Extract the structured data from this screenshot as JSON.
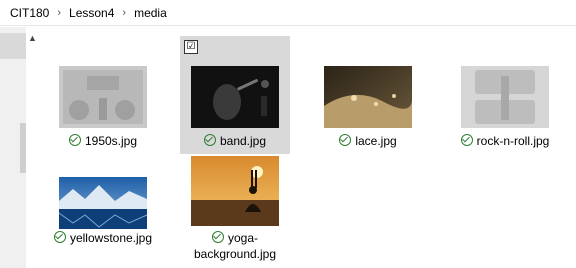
{
  "breadcrumb": {
    "items": [
      "CIT180",
      "Lesson4",
      "media"
    ],
    "separator": "›"
  },
  "files": [
    {
      "name": "1950s.jpg",
      "status": "synced",
      "selected": false
    },
    {
      "name": "band.jpg",
      "status": "synced",
      "selected": true
    },
    {
      "name": "lace.jpg",
      "status": "synced",
      "selected": false
    },
    {
      "name": "rock-n-roll.jpg",
      "status": "synced",
      "selected": false
    },
    {
      "name": "yellowstone.jpg",
      "status": "synced",
      "selected": false
    },
    {
      "name": "yoga-background.jpg",
      "status": "synced",
      "selected": false
    }
  ],
  "selection_checkbox": "☑",
  "scroll_up_icon": "▲",
  "colors": {
    "selected_bg": "#d9d9d9",
    "check_green": "#2e7d32"
  }
}
